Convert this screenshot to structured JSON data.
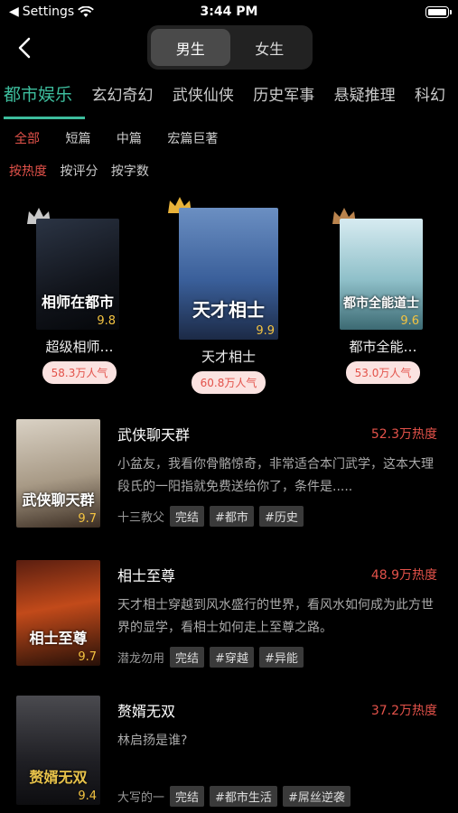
{
  "status": {
    "carrier": "Settings",
    "time": "3:44 PM"
  },
  "gender_tabs": [
    {
      "label": "男生",
      "active": true
    },
    {
      "label": "女生",
      "active": false
    }
  ],
  "categories": [
    "都市娱乐",
    "玄幻奇幻",
    "武侠仙侠",
    "历史军事",
    "悬疑推理",
    "科幻"
  ],
  "length_filters": [
    "全部",
    "短篇",
    "中篇",
    "宏篇巨著"
  ],
  "sort_filters": [
    "按热度",
    "按评分",
    "按字数"
  ],
  "top3": [
    {
      "name": "超级相师…",
      "popularity": "58.3万人气",
      "score": "9.8",
      "cover_text": "相师在都市",
      "crown": "silver"
    },
    {
      "name": "天才相士",
      "popularity": "60.8万人气",
      "score": "9.9",
      "cover_text": "天才相士",
      "crown": "gold"
    },
    {
      "name": "都市全能…",
      "popularity": "53.0万人气",
      "score": "9.6",
      "cover_text": "都市全能道士",
      "crown": "bronze"
    }
  ],
  "books": [
    {
      "title": "武侠聊天群",
      "heat": "52.3万热度",
      "desc": "小盆友，我看你骨骼惊奇，非常适合本门武学，这本大理段氏的一阳指就免费送给你了，条件是.....",
      "author": "十三教父",
      "status": "完结",
      "tags": [
        "#都市",
        "#历史"
      ],
      "score": "9.7",
      "cover_text": "武侠聊天群"
    },
    {
      "title": "相士至尊",
      "heat": "48.9万热度",
      "desc": "天才相士穿越到风水盛行的世界，看风水如何成为此方世界的显学，看相士如何走上至尊之路。",
      "author": "潜龙勿用",
      "status": "完结",
      "tags": [
        "#穿越",
        "#异能"
      ],
      "score": "9.7",
      "cover_text": "相士至尊"
    },
    {
      "title": "赘婿无双",
      "heat": "37.2万热度",
      "desc": "林启扬是谁?",
      "author": "大写的一",
      "status": "完结",
      "tags": [
        "#都市生活",
        "#屌丝逆袭"
      ],
      "score": "9.4",
      "cover_text": "赘婿无双"
    }
  ],
  "colors": {
    "accent": "#3dbd9d",
    "heat": "#e3524a",
    "score": "#f3c341"
  }
}
